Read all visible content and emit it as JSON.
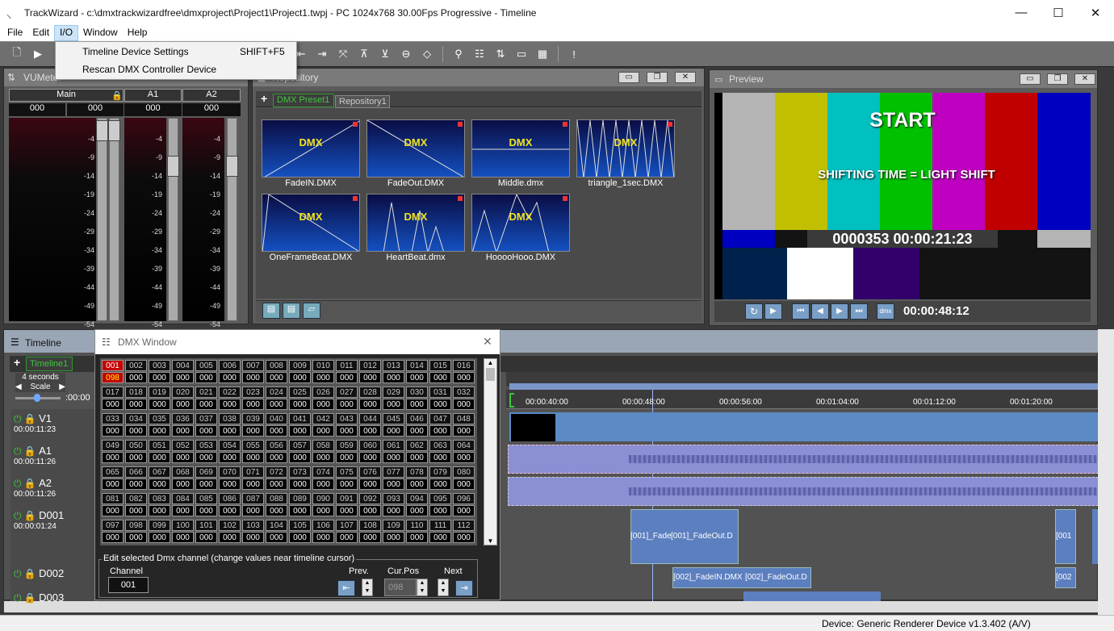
{
  "app": {
    "title": "TrackWizard - c:\\dmxtrackwizardfree\\dmxproject\\Project1\\Project1.twpj - PC 1024x768 30.00Fps Progressive - Timeline"
  },
  "menu": [
    "File",
    "Edit",
    "I/O",
    "Window",
    "Help"
  ],
  "io_menu": {
    "items": [
      {
        "label": "Timeline Device Settings",
        "shortcut": "SHIFT+F5"
      },
      {
        "label": "Rescan DMX Controller Device",
        "shortcut": ""
      }
    ]
  },
  "vumeter": {
    "title": "VUMeter",
    "channels": [
      {
        "name": "Main",
        "value": "000",
        "value2": "000"
      },
      {
        "name": "A1",
        "value": "000"
      },
      {
        "name": "A2",
        "value": "000"
      }
    ],
    "scale": [
      "-4",
      "-9",
      "-14",
      "-19",
      "-24",
      "-29",
      "-34",
      "-39",
      "-44",
      "-49",
      "-54"
    ]
  },
  "repository": {
    "title": "Repository",
    "tabs": [
      "DMX Preset1",
      "Repository1"
    ],
    "thumb_label": "DMX",
    "items": [
      "FadeIN.DMX",
      "FadeOut.DMX",
      "Middle.dmx",
      "triangle_1sec.DMX",
      "OneFrameBeat.DMX",
      "HeartBeat.dmx",
      "HooooHooo.DMX"
    ]
  },
  "preview": {
    "title": "Preview",
    "start_text": "START",
    "shift_text": "SHIFTING TIME = LIGHT SHIFT",
    "timecode": "0000353 00:00:21:23",
    "time": "00:00:48:12",
    "dmx_btn": "dmx"
  },
  "timeline": {
    "title": "Timeline",
    "tab": "Timeline1",
    "seconds": "4 seconds",
    "scale": "Scale",
    "ruler_left": ":00:00",
    "ruler": [
      "00:00:40:00",
      "00:00:48:00",
      "00:00:56:00",
      "00:01:04:00",
      "00:01:12:00",
      "00:01:20:00"
    ],
    "tracks": [
      {
        "name": "V1",
        "time": "00:00:11:23"
      },
      {
        "name": "A1",
        "time": "00:00:11:26"
      },
      {
        "name": "A2",
        "time": "00:00:11:26"
      },
      {
        "name": "D001",
        "time": "00:00:01:24"
      },
      {
        "name": "D002",
        "time": ""
      },
      {
        "name": "D003",
        "time": ""
      }
    ],
    "clips": {
      "d001_a": "[001]_Fade",
      "d001_b": "[001]_FadeOut.D",
      "d001_c": "[001",
      "d002_a": "[002]_FadeIN.DMX",
      "d002_b": "[002]_FadeOut.D",
      "d002_c": "[002"
    }
  },
  "dmx_window": {
    "title": "DMX Window",
    "selected_value": "098",
    "edit_legend": "Edit selected Dmx channel (change values near timeline cursor)",
    "channel_label": "Channel",
    "channel_value": "001",
    "prev": "Prev.",
    "curpos": "Cur.Pos",
    "curpos_value": "098",
    "next": "Next"
  },
  "status": "Device: Generic Renderer Device v1.3.402 (A/V)",
  "colors": {
    "accent_green": "#3ec63e",
    "dmx_red": "#c40000",
    "dmx_yellow": "#f4e41c"
  }
}
